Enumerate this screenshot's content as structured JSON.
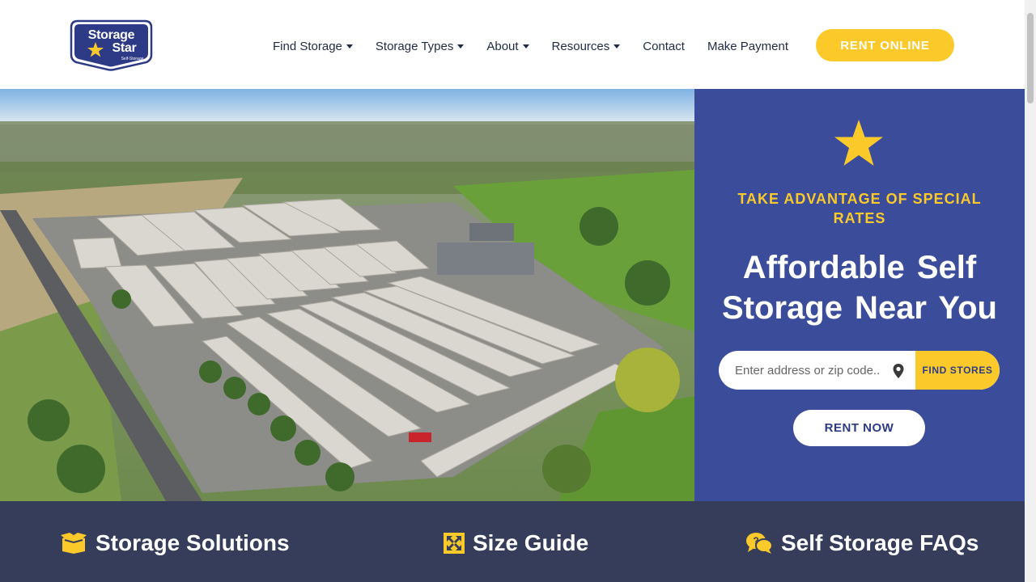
{
  "brand": {
    "logo_line1": "Storage",
    "logo_line2": "Star",
    "logo_line3": "Self-Storage",
    "primary_color": "#3b4c9b",
    "accent_color": "#fbca2a",
    "band_color": "#363d5a"
  },
  "nav": {
    "items": [
      {
        "label": "Find Storage",
        "dropdown": true
      },
      {
        "label": "Storage Types",
        "dropdown": true
      },
      {
        "label": "About",
        "dropdown": true
      },
      {
        "label": "Resources",
        "dropdown": true
      },
      {
        "label": "Contact",
        "dropdown": false
      },
      {
        "label": "Make Payment",
        "dropdown": false
      }
    ],
    "cta_label": "RENT ONLINE"
  },
  "hero": {
    "image_icon": "aerial-storage-facility-photo",
    "star_icon": "star-icon",
    "tagline": "TAKE ADVANTAGE OF SPECIAL RATES",
    "title": "Affordable Self Storage Near You",
    "search": {
      "placeholder": "Enter address or zip code..",
      "value": "",
      "pin_icon": "location-pin-icon",
      "button_label": "FIND STORES"
    },
    "rent_now_label": "RENT NOW"
  },
  "features": [
    {
      "icon": "box-icon",
      "label": "Storage Solutions"
    },
    {
      "icon": "expand-arrows-icon",
      "label": "Size Guide"
    },
    {
      "icon": "chat-question-icon",
      "label": "Self Storage FAQs"
    }
  ]
}
